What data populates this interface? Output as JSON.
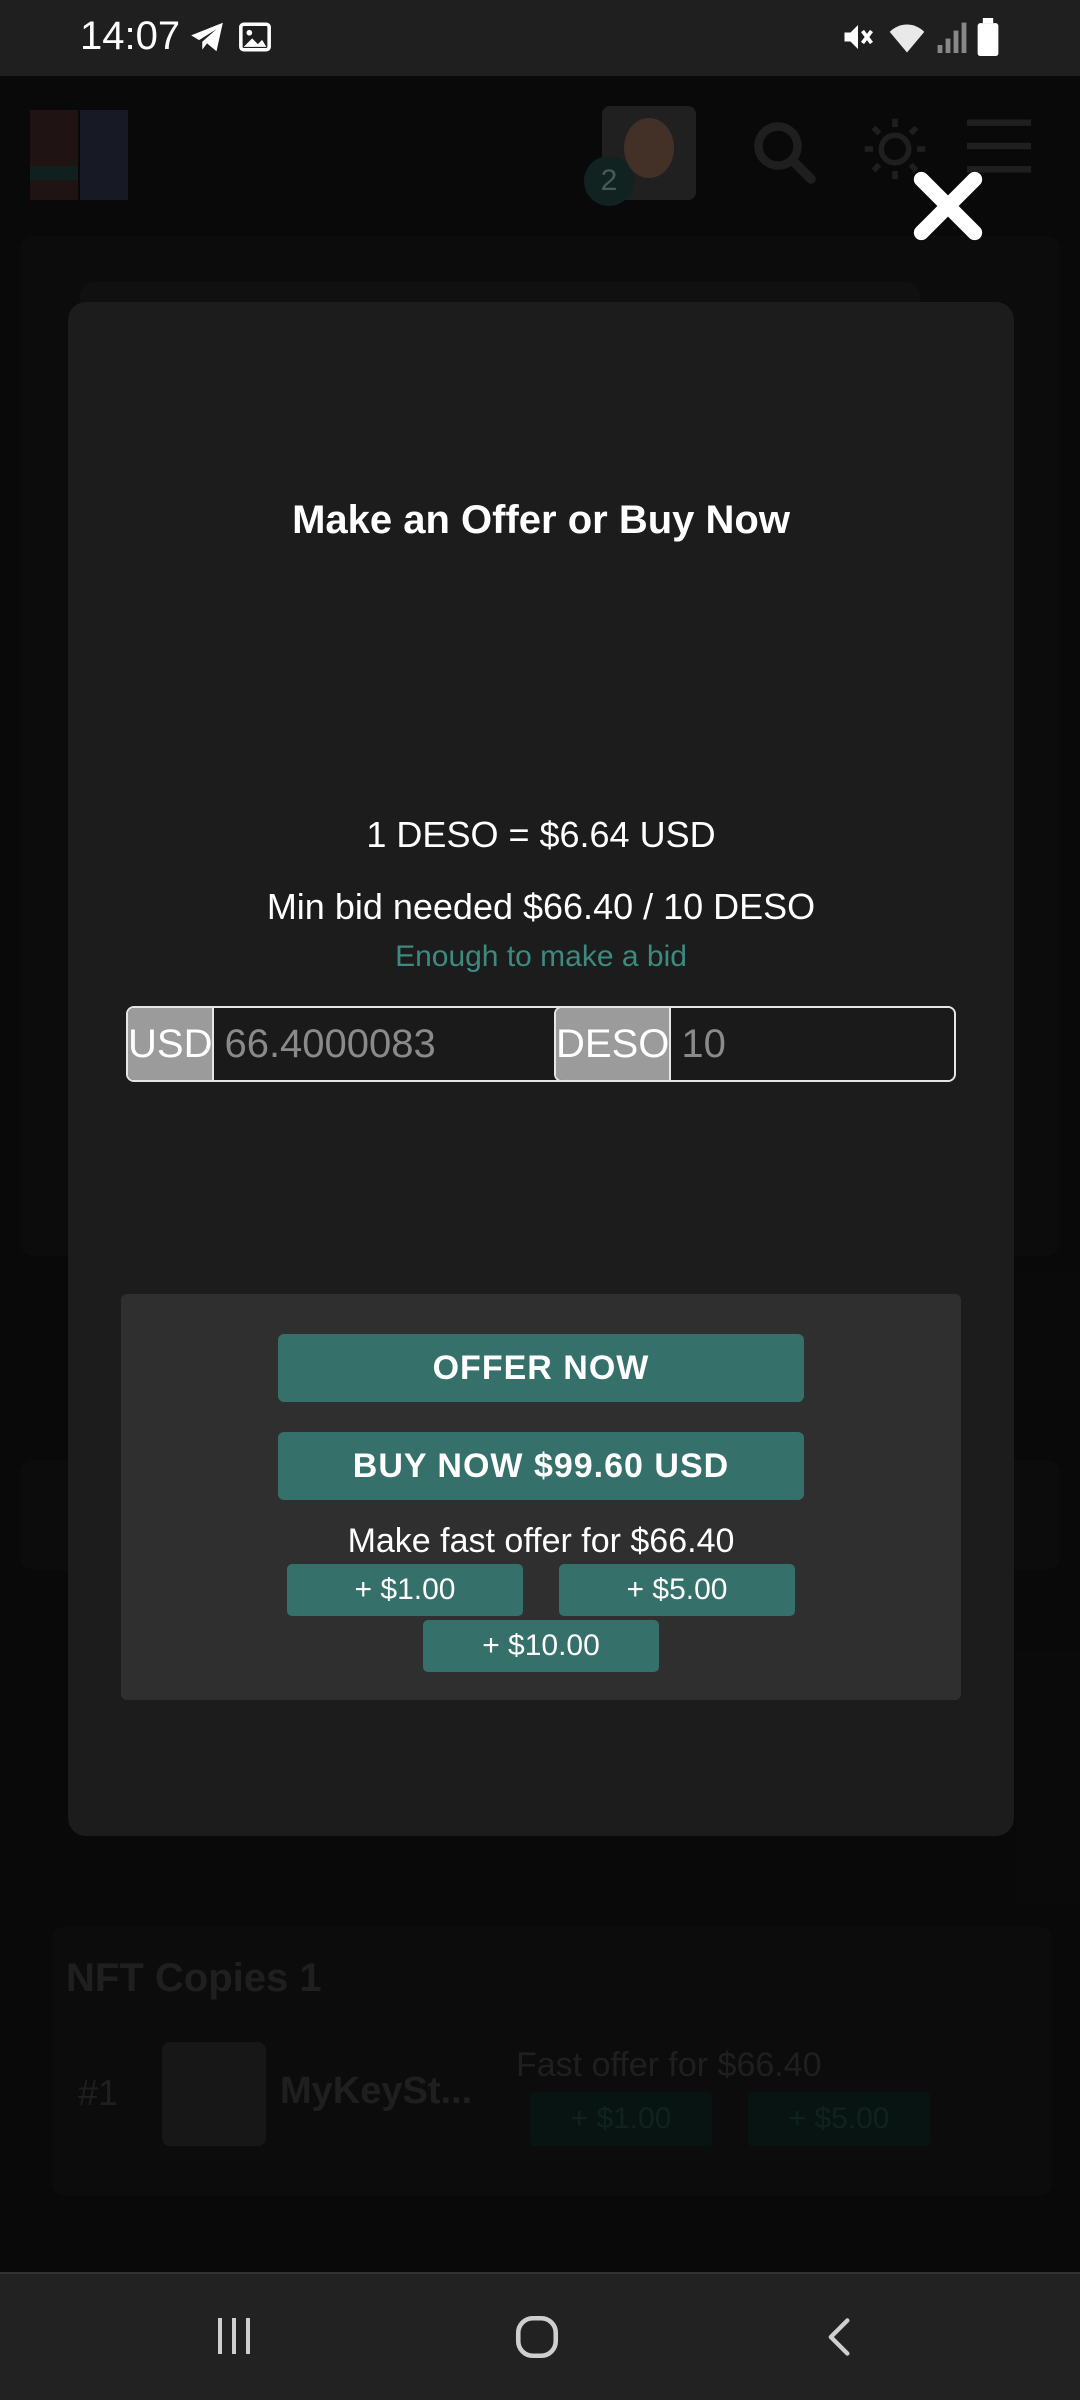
{
  "status_bar": {
    "time": "14:07",
    "icons": [
      "telegram-icon",
      "gallery-icon",
      "mute-icon",
      "wifi-icon",
      "signal-icon",
      "battery-icon"
    ]
  },
  "header": {
    "notification_count": "2",
    "icons": [
      "logo-icon",
      "search-icon",
      "theme-toggle-icon",
      "menu-icon"
    ]
  },
  "background_page": {
    "nft_copies_title": "NFT Copies 1",
    "row_index": "#1",
    "row_user": "MyKeySt...",
    "row_fast_offer": "Fast offer for $66.40",
    "row_btn_1": "+ $1.00",
    "row_btn_2": "+ $5.00"
  },
  "modal": {
    "title": "Make an Offer or Buy Now",
    "rate": "1 DESO = $6.64 USD",
    "min_bid": "Min bid needed $66.40 / 10 DESO",
    "enough": "Enough to make a bid",
    "usd_label": "USD",
    "usd_value": "66.4000083",
    "deso_label": "DESO",
    "deso_value": "10",
    "offer_now": "OFFER NOW",
    "buy_now": "BUY NOW $99.60 USD",
    "fast_offer_label": "Make fast offer for $66.40",
    "fast_1": "+ $1.00",
    "fast_5": "+ $5.00",
    "fast_10": "+ $10.00"
  },
  "colors": {
    "accent": "#36706a",
    "success_text": "#3c8a80",
    "modal_bg": "#1c1c1c",
    "panel_bg": "#2f2f2f"
  }
}
